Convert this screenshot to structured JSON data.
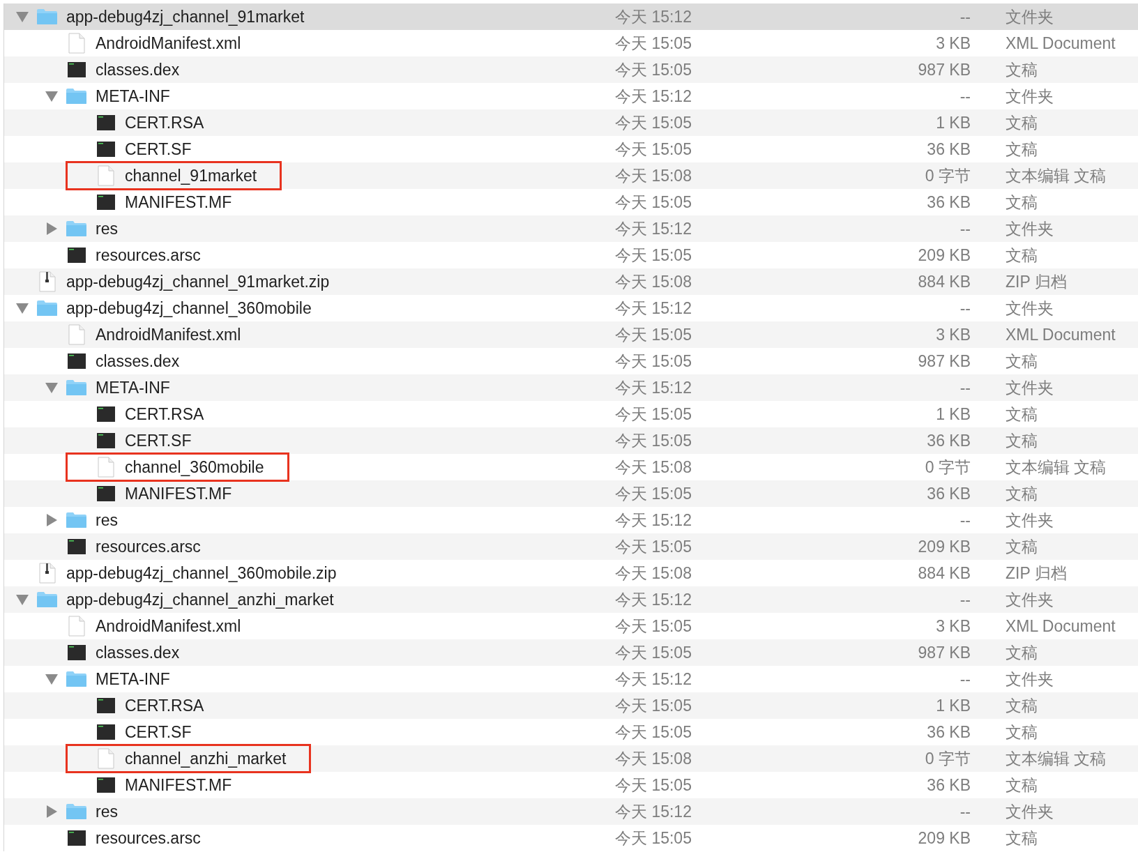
{
  "file_list": [
    {
      "name": "app-debug4zj_channel_91market",
      "kind": "folder",
      "expanded": true,
      "selected": true,
      "highlighted": false,
      "date": "今天 15:12",
      "size": "--",
      "type_label": "文件夹",
      "children": [
        {
          "name": "AndroidManifest.xml",
          "kind": "document",
          "selected": false,
          "highlighted": false,
          "date": "今天 15:05",
          "size": "3 KB",
          "type_label": "XML Document"
        },
        {
          "name": "classes.dex",
          "kind": "binary",
          "selected": false,
          "highlighted": false,
          "date": "今天 15:05",
          "size": "987 KB",
          "type_label": "文稿"
        },
        {
          "name": "META-INF",
          "kind": "folder",
          "expanded": true,
          "selected": false,
          "highlighted": false,
          "date": "今天 15:12",
          "size": "--",
          "type_label": "文件夹",
          "children": [
            {
              "name": "CERT.RSA",
              "kind": "binary",
              "selected": false,
              "highlighted": false,
              "date": "今天 15:05",
              "size": "1 KB",
              "type_label": "文稿"
            },
            {
              "name": "CERT.SF",
              "kind": "binary",
              "selected": false,
              "highlighted": false,
              "date": "今天 15:05",
              "size": "36 KB",
              "type_label": "文稿"
            },
            {
              "name": "channel_91market",
              "kind": "document",
              "selected": false,
              "highlighted": true,
              "date": "今天 15:08",
              "size": "0 字节",
              "type_label": "文本编辑 文稿"
            },
            {
              "name": "MANIFEST.MF",
              "kind": "binary",
              "selected": false,
              "highlighted": false,
              "date": "今天 15:05",
              "size": "36 KB",
              "type_label": "文稿"
            }
          ]
        },
        {
          "name": "res",
          "kind": "folder",
          "expanded": false,
          "selected": false,
          "highlighted": false,
          "date": "今天 15:12",
          "size": "--",
          "type_label": "文件夹"
        },
        {
          "name": "resources.arsc",
          "kind": "binary",
          "selected": false,
          "highlighted": false,
          "date": "今天 15:05",
          "size": "209 KB",
          "type_label": "文稿"
        }
      ]
    },
    {
      "name": "app-debug4zj_channel_91market.zip",
      "kind": "zip",
      "selected": false,
      "highlighted": false,
      "date": "今天 15:08",
      "size": "884 KB",
      "type_label": "ZIP 归档"
    },
    {
      "name": "app-debug4zj_channel_360mobile",
      "kind": "folder",
      "expanded": true,
      "selected": false,
      "highlighted": false,
      "date": "今天 15:12",
      "size": "--",
      "type_label": "文件夹",
      "children": [
        {
          "name": "AndroidManifest.xml",
          "kind": "document",
          "selected": false,
          "highlighted": false,
          "date": "今天 15:05",
          "size": "3 KB",
          "type_label": "XML Document"
        },
        {
          "name": "classes.dex",
          "kind": "binary",
          "selected": false,
          "highlighted": false,
          "date": "今天 15:05",
          "size": "987 KB",
          "type_label": "文稿"
        },
        {
          "name": "META-INF",
          "kind": "folder",
          "expanded": true,
          "selected": false,
          "highlighted": false,
          "date": "今天 15:12",
          "size": "--",
          "type_label": "文件夹",
          "children": [
            {
              "name": "CERT.RSA",
              "kind": "binary",
              "selected": false,
              "highlighted": false,
              "date": "今天 15:05",
              "size": "1 KB",
              "type_label": "文稿"
            },
            {
              "name": "CERT.SF",
              "kind": "binary",
              "selected": false,
              "highlighted": false,
              "date": "今天 15:05",
              "size": "36 KB",
              "type_label": "文稿"
            },
            {
              "name": "channel_360mobile",
              "kind": "document",
              "selected": false,
              "highlighted": true,
              "date": "今天 15:08",
              "size": "0 字节",
              "type_label": "文本编辑 文稿"
            },
            {
              "name": "MANIFEST.MF",
              "kind": "binary",
              "selected": false,
              "highlighted": false,
              "date": "今天 15:05",
              "size": "36 KB",
              "type_label": "文稿"
            }
          ]
        },
        {
          "name": "res",
          "kind": "folder",
          "expanded": false,
          "selected": false,
          "highlighted": false,
          "date": "今天 15:12",
          "size": "--",
          "type_label": "文件夹"
        },
        {
          "name": "resources.arsc",
          "kind": "binary",
          "selected": false,
          "highlighted": false,
          "date": "今天 15:05",
          "size": "209 KB",
          "type_label": "文稿"
        }
      ]
    },
    {
      "name": "app-debug4zj_channel_360mobile.zip",
      "kind": "zip",
      "selected": false,
      "highlighted": false,
      "date": "今天 15:08",
      "size": "884 KB",
      "type_label": "ZIP 归档"
    },
    {
      "name": "app-debug4zj_channel_anzhi_market",
      "kind": "folder",
      "expanded": true,
      "selected": false,
      "highlighted": false,
      "date": "今天 15:12",
      "size": "--",
      "type_label": "文件夹",
      "children": [
        {
          "name": "AndroidManifest.xml",
          "kind": "document",
          "selected": false,
          "highlighted": false,
          "date": "今天 15:05",
          "size": "3 KB",
          "type_label": "XML Document"
        },
        {
          "name": "classes.dex",
          "kind": "binary",
          "selected": false,
          "highlighted": false,
          "date": "今天 15:05",
          "size": "987 KB",
          "type_label": "文稿"
        },
        {
          "name": "META-INF",
          "kind": "folder",
          "expanded": true,
          "selected": false,
          "highlighted": false,
          "date": "今天 15:12",
          "size": "--",
          "type_label": "文件夹",
          "children": [
            {
              "name": "CERT.RSA",
              "kind": "binary",
              "selected": false,
              "highlighted": false,
              "date": "今天 15:05",
              "size": "1 KB",
              "type_label": "文稿"
            },
            {
              "name": "CERT.SF",
              "kind": "binary",
              "selected": false,
              "highlighted": false,
              "date": "今天 15:05",
              "size": "36 KB",
              "type_label": "文稿"
            },
            {
              "name": "channel_anzhi_market",
              "kind": "document",
              "selected": false,
              "highlighted": true,
              "date": "今天 15:08",
              "size": "0 字节",
              "type_label": "文本编辑 文稿"
            },
            {
              "name": "MANIFEST.MF",
              "kind": "binary",
              "selected": false,
              "highlighted": false,
              "date": "今天 15:05",
              "size": "36 KB",
              "type_label": "文稿"
            }
          ]
        },
        {
          "name": "res",
          "kind": "folder",
          "expanded": false,
          "selected": false,
          "highlighted": false,
          "date": "今天 15:12",
          "size": "--",
          "type_label": "文件夹"
        },
        {
          "name": "resources.arsc",
          "kind": "binary",
          "selected": false,
          "highlighted": false,
          "date": "今天 15:05",
          "size": "209 KB",
          "type_label": "文稿"
        }
      ]
    }
  ]
}
